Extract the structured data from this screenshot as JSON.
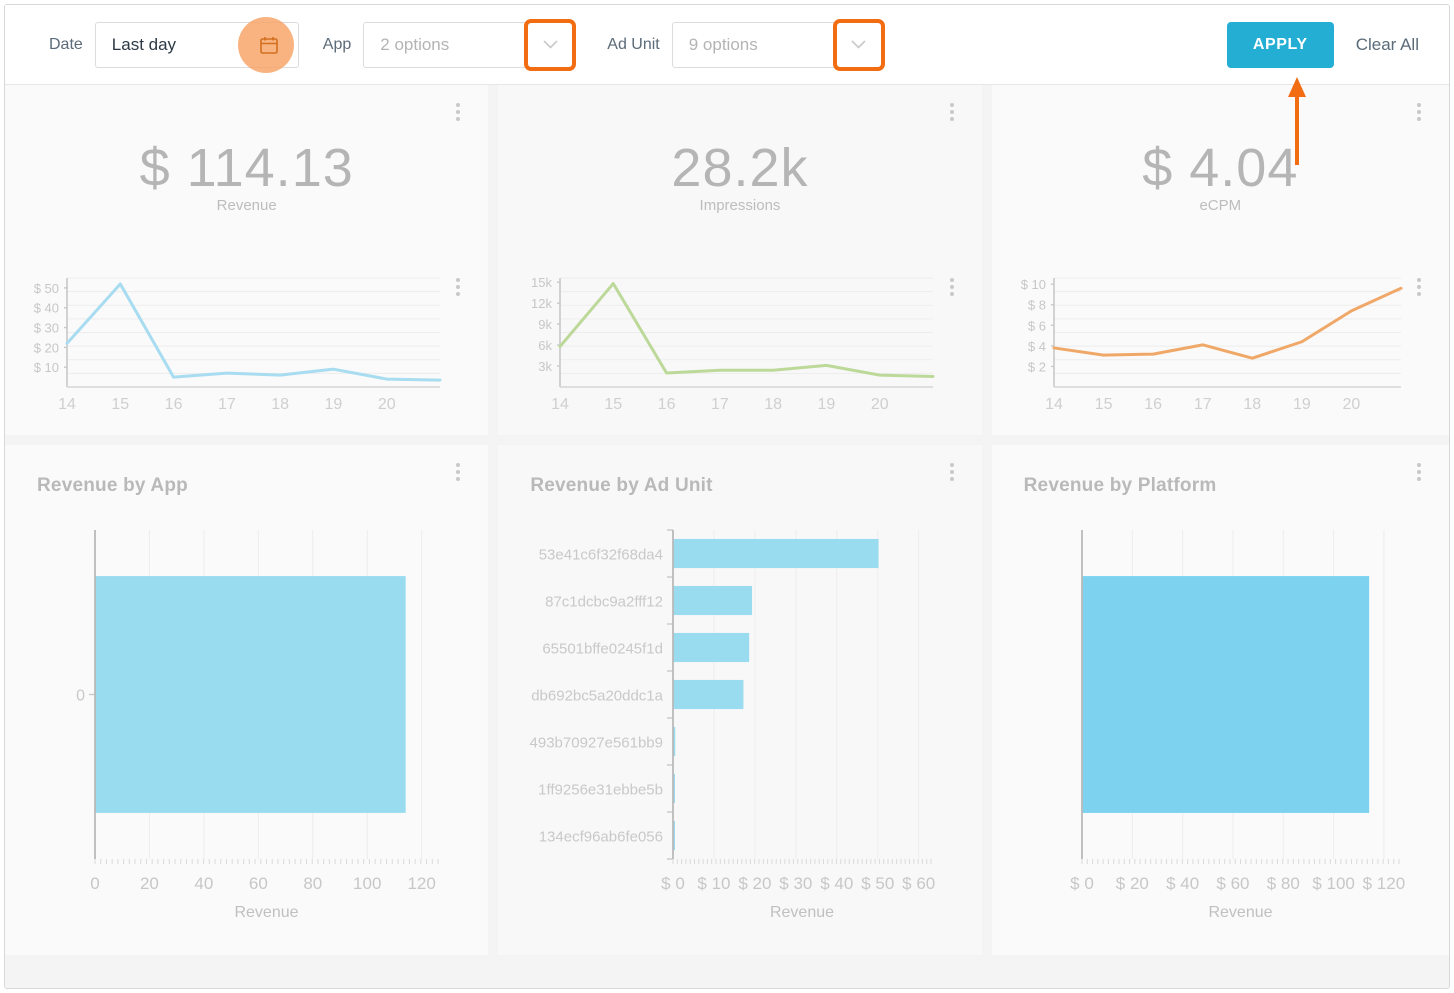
{
  "filters": {
    "date": {
      "label": "Date",
      "value": "Last day",
      "icon": "calendar-icon"
    },
    "app": {
      "label": "App",
      "value": "2 options",
      "icon": "chevron-down-icon"
    },
    "ad_unit": {
      "label": "Ad Unit",
      "value": "9 options",
      "icon": "chevron-down-icon"
    },
    "apply_label": "APPLY",
    "clear_label": "Clear All",
    "accent_color": "#24aed4",
    "annotation_color": "#f26c12"
  },
  "kpis": [
    {
      "value": "$ 114.13",
      "label": "Revenue"
    },
    {
      "value": "28.2k",
      "label": "Impressions"
    },
    {
      "value": "$ 4.04",
      "label": "eCPM"
    }
  ],
  "panels": [
    {
      "title": "Revenue by App"
    },
    {
      "title": "Revenue by Ad Unit"
    },
    {
      "title": "Revenue by Platform"
    }
  ],
  "chart_data": [
    {
      "type": "line",
      "name": "revenue-sparkline",
      "title": "Revenue",
      "color": "#a8dcf0",
      "x": [
        14,
        15,
        16,
        17,
        18,
        19,
        20,
        21
      ],
      "xlabel": "",
      "ylabel": "",
      "values": [
        22,
        52,
        5,
        7,
        6,
        9,
        4,
        3.5
      ],
      "ytick_labels": [
        "$ 50",
        "$ 40",
        "$ 30",
        "$ 20",
        "$ 10"
      ],
      "ytick_values": [
        50,
        40,
        30,
        20,
        10
      ],
      "xtick_labels": [
        "14",
        "15",
        "16",
        "17",
        "18",
        "19",
        "20"
      ],
      "ylim": [
        0,
        55
      ],
      "grid": true
    },
    {
      "type": "line",
      "name": "impressions-sparkline",
      "title": "Impressions",
      "color": "#bdd99a",
      "x": [
        14,
        15,
        16,
        17,
        18,
        19,
        20,
        21
      ],
      "xlabel": "",
      "ylabel": "",
      "values": [
        5800,
        14800,
        2000,
        2400,
        2400,
        3100,
        1700,
        1500
      ],
      "ytick_labels": [
        "15k",
        "12k",
        "9k",
        "6k",
        "3k"
      ],
      "ytick_values": [
        15000,
        12000,
        9000,
        6000,
        3000
      ],
      "xtick_labels": [
        "14",
        "15",
        "16",
        "17",
        "18",
        "19",
        "20"
      ],
      "ylim": [
        0,
        15600
      ],
      "grid": true
    },
    {
      "type": "line",
      "name": "ecpm-sparkline",
      "title": "eCPM",
      "color": "#f0a868",
      "x": [
        14,
        15,
        16,
        17,
        18,
        19,
        20,
        21
      ],
      "xlabel": "",
      "ylabel": "",
      "values": [
        3.8,
        3.1,
        3.2,
        4.1,
        2.8,
        4.4,
        7.4,
        9.6
      ],
      "ytick_labels": [
        "$ 10",
        "$ 8",
        "$ 6",
        "$ 4",
        "$ 2"
      ],
      "ytick_values": [
        10,
        8,
        6,
        4,
        2
      ],
      "xtick_labels": [
        "14",
        "15",
        "16",
        "17",
        "18",
        "19",
        "20"
      ],
      "ylim": [
        0,
        10.6
      ],
      "grid": true
    },
    {
      "type": "bar",
      "orientation": "horizontal",
      "name": "revenue-by-app",
      "title": "Revenue by App",
      "color": "#9adcef",
      "categories": [
        "0"
      ],
      "values": [
        114.13
      ],
      "xlabel": "Revenue",
      "ylabel": "",
      "xtick_labels": [
        "0",
        "20",
        "40",
        "60",
        "80",
        "100",
        "120"
      ],
      "xtick_values": [
        0,
        20,
        40,
        60,
        80,
        100,
        120
      ],
      "xlim": [
        0,
        126
      ],
      "grid": true
    },
    {
      "type": "bar",
      "orientation": "horizontal",
      "name": "revenue-by-ad-unit",
      "title": "Revenue by Ad Unit",
      "color": "#9adcef",
      "categories": [
        "53e41c6f32f68da4",
        "87c1dcbc9a2fff12",
        "65501bffe0245f1d",
        "db692bc5a20ddc1a",
        "493b70927e561bb9",
        "1ff9256e31ebbe5b",
        "134ecf96ab6fe056"
      ],
      "values": [
        50.2,
        19.3,
        18.6,
        17.2,
        0.55,
        0.45,
        0.25
      ],
      "xlabel": "Revenue",
      "ylabel": "",
      "xtick_labels": [
        "$ 0",
        "$ 10",
        "$ 20",
        "$ 30",
        "$ 40",
        "$ 50",
        "$ 60"
      ],
      "xtick_values": [
        0,
        10,
        20,
        30,
        40,
        50,
        60
      ],
      "xlim": [
        0,
        63
      ],
      "grid": true
    },
    {
      "type": "bar",
      "orientation": "horizontal",
      "name": "revenue-by-platform",
      "title": "Revenue by Platform",
      "color": "#7dd3ef",
      "categories": [
        ""
      ],
      "values": [
        114.13
      ],
      "xlabel": "Revenue",
      "ylabel": "",
      "xtick_labels": [
        "$ 0",
        "$ 20",
        "$ 40",
        "$ 60",
        "$ 80",
        "$ 100",
        "$ 120"
      ],
      "xtick_values": [
        0,
        20,
        40,
        60,
        80,
        100,
        120
      ],
      "xlim": [
        0,
        126
      ],
      "grid": true
    }
  ]
}
